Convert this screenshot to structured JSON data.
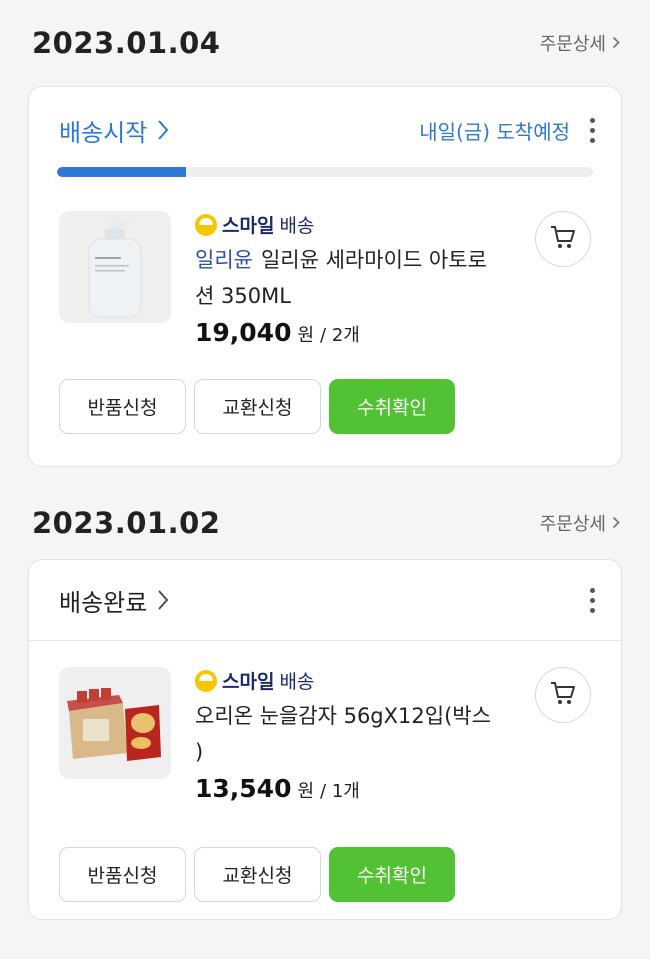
{
  "orders": [
    {
      "date": "2023.01.04",
      "detail_label": "주문상세",
      "status": "배송시작",
      "eta": "내일(금) 도착예정",
      "progress": 0.24,
      "badge_label": "스마일",
      "badge_suffix": "배송",
      "brand": "일리윤",
      "product_line1": "일리윤 세라마이드 아토로",
      "product_line2": "션 350ML",
      "price": "19,040",
      "currency": "원",
      "qty": "/ 2개",
      "buttons": {
        "return": "반품신청",
        "exchange": "교환신청",
        "confirm": "수취확인"
      }
    },
    {
      "date": "2023.01.02",
      "detail_label": "주문상세",
      "status": "배송완료",
      "badge_label": "스마일",
      "badge_suffix": "배송",
      "product_line1": "오리온 눈을감자 56gX12입(박스",
      "product_line2": ")",
      "price": "13,540",
      "currency": "원",
      "qty": "/ 1개",
      "buttons": {
        "return": "반품신청",
        "exchange": "교환신청",
        "confirm": "수취확인"
      }
    }
  ],
  "colors": {
    "accent_blue": "#2f78d6",
    "confirm_green": "#52c234",
    "badge_yellow": "#f7c600"
  }
}
